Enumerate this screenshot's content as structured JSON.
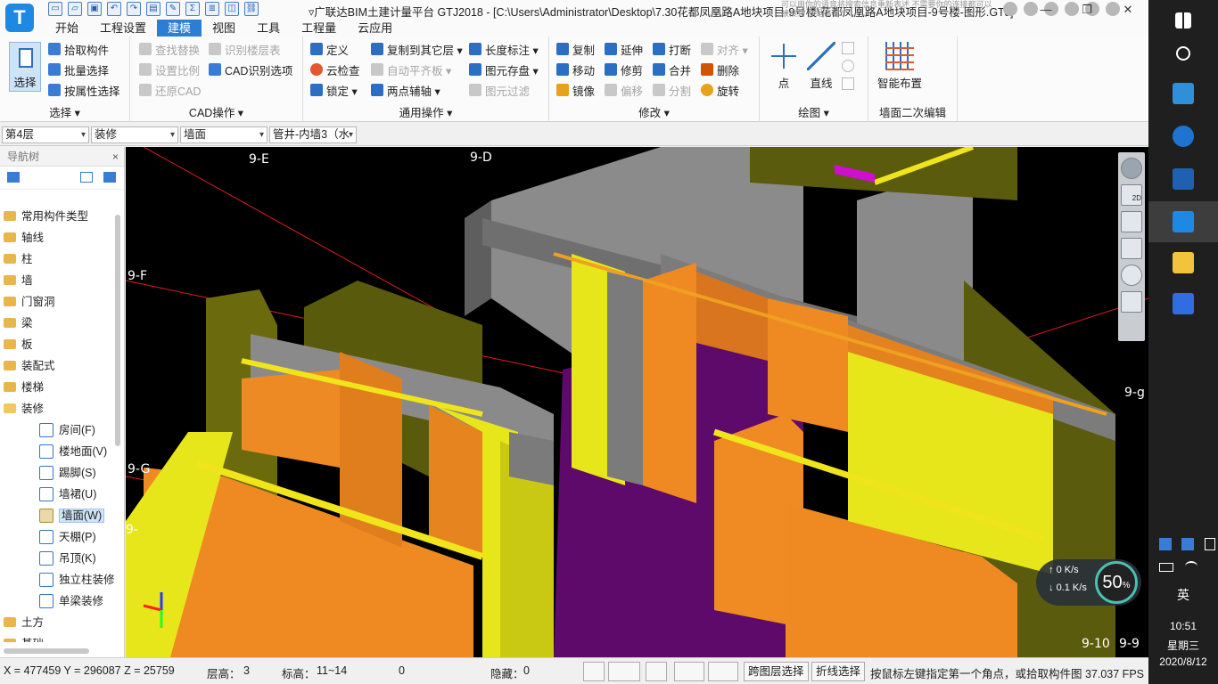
{
  "window": {
    "title": "▿广联达BIM土建计量平台 GTJ2018 - [C:\\Users\\Administrator\\Desktop\\7.30花都凤凰路A地块项目-9号楼\\花都凤凰路A地块项目-9号楼-图形.GTJ]",
    "logo": "T",
    "search_hint": "可以用你的语音将搜索信息重新表述 不需要你的连接都可以被搜到 你是谁呢？",
    "controls": [
      "—",
      "❐",
      "✕"
    ]
  },
  "menu": {
    "tabs": [
      "开始",
      "工程设置",
      "建模",
      "视图",
      "工具",
      "工程量",
      "云应用"
    ],
    "active_index": 2
  },
  "ribbon": {
    "select_group": {
      "select": "选择",
      "pick": "拾取构件",
      "batch": "批量选择",
      "by_attr": "按属性选择",
      "label": "选择 ▾"
    },
    "cad_group": {
      "find_replace": "查找替换",
      "identify_floor": "识别楼层表",
      "set_scale": "设置比例",
      "cad_identify": "CAD识别选项",
      "restore_cad": "还原CAD",
      "label": "CAD操作 ▾"
    },
    "common_group": {
      "define": "定义",
      "copy_to_floor": "复制到其它层 ▾",
      "length_dim": "长度标注 ▾",
      "cloud_check": "云检查",
      "auto_level": "自动平齐板 ▾",
      "element_save": "图元存盘 ▾",
      "lock": "锁定 ▾",
      "two_point_axis": "两点辅轴 ▾",
      "element_filter": "图元过滤",
      "label": "通用操作 ▾"
    },
    "modify_group": {
      "copy": "复制",
      "extend": "延伸",
      "break": "打断",
      "align": "对齐 ▾",
      "move": "移动",
      "trim": "修剪",
      "merge": "合并",
      "delete": "删除",
      "mirror": "镜像",
      "offset": "偏移",
      "split": "分割",
      "rotate": "旋转",
      "label": "修改 ▾"
    },
    "draw_group": {
      "point": "点",
      "line": "直线",
      "label": "绘图 ▾"
    },
    "wall_group": {
      "smart_layout": "智能布置",
      "label": "墙面二次编辑"
    }
  },
  "selectors": {
    "floor": "第4层",
    "category": "装修",
    "type": "墙面",
    "element": "管井-内墙3（水"
  },
  "nav": {
    "title": "导航树",
    "close": "×",
    "items": [
      {
        "label": "常用构件类型"
      },
      {
        "label": "轴线"
      },
      {
        "label": "柱"
      },
      {
        "label": "墙"
      },
      {
        "label": "门窗洞"
      },
      {
        "label": "梁"
      },
      {
        "label": "板"
      },
      {
        "label": "装配式"
      },
      {
        "label": "楼梯"
      },
      {
        "label": "装修"
      }
    ],
    "sub_items": [
      {
        "label": "房间(F)"
      },
      {
        "label": "楼地面(V)"
      },
      {
        "label": "踢脚(S)"
      },
      {
        "label": "墙裙(U)"
      },
      {
        "label": "墙面(W)"
      },
      {
        "label": "天棚(P)"
      },
      {
        "label": "吊顶(K)"
      },
      {
        "label": "独立柱装修"
      },
      {
        "label": "单梁装修"
      }
    ],
    "tail_items": [
      {
        "label": "土方"
      },
      {
        "label": "基础"
      }
    ]
  },
  "viewport": {
    "axis_labels": [
      "9-E",
      "9-D",
      "9-F",
      "9-G",
      "9-",
      "9-g",
      "9-10",
      "9-9"
    ],
    "tools": [
      "orbit-icon",
      "view-2d-icon",
      "view-3d-icon",
      "box-icon",
      "rotate-icon",
      "grid-icon"
    ],
    "tool_2d_label": "2D"
  },
  "colors": {
    "wall_orange": "#f08a23",
    "wall_yellow": "#e6e61a",
    "floor_purple": "#6a0a6e",
    "wall_grey": "#8a8a8a",
    "olive": "#6b6b0e",
    "accent_blue": "#2a7fd4"
  },
  "status": {
    "coords": "X = 477459 Y = 296087 Z = 25759",
    "floor_height_label": "层高：",
    "floor_height": "3",
    "elevation_label": "标高：",
    "elevation": "11~14",
    "count": "0",
    "hidden_label": "隐藏：",
    "hidden": "0",
    "cross_layer": "跨图层选择",
    "polyline_select": "折线选择",
    "hint": "按鼠标左键指定第一个角点，或拾取构件图 37.037 FPS"
  },
  "netspeed": {
    "up": "0",
    "up_unit": "K/s",
    "down": "0.1",
    "down_unit": "K/s",
    "percent": "50",
    "percent_sign": "%"
  },
  "taskbar": {
    "time": "10:51",
    "weekday": "星期三",
    "date": "2020/8/12",
    "ime": "英",
    "apps": [
      "windows-icon",
      "cortana-icon",
      "app-icon",
      "ie-icon",
      "cad-icon",
      "gtj-icon",
      "explorer-icon",
      "wps-icon"
    ]
  }
}
